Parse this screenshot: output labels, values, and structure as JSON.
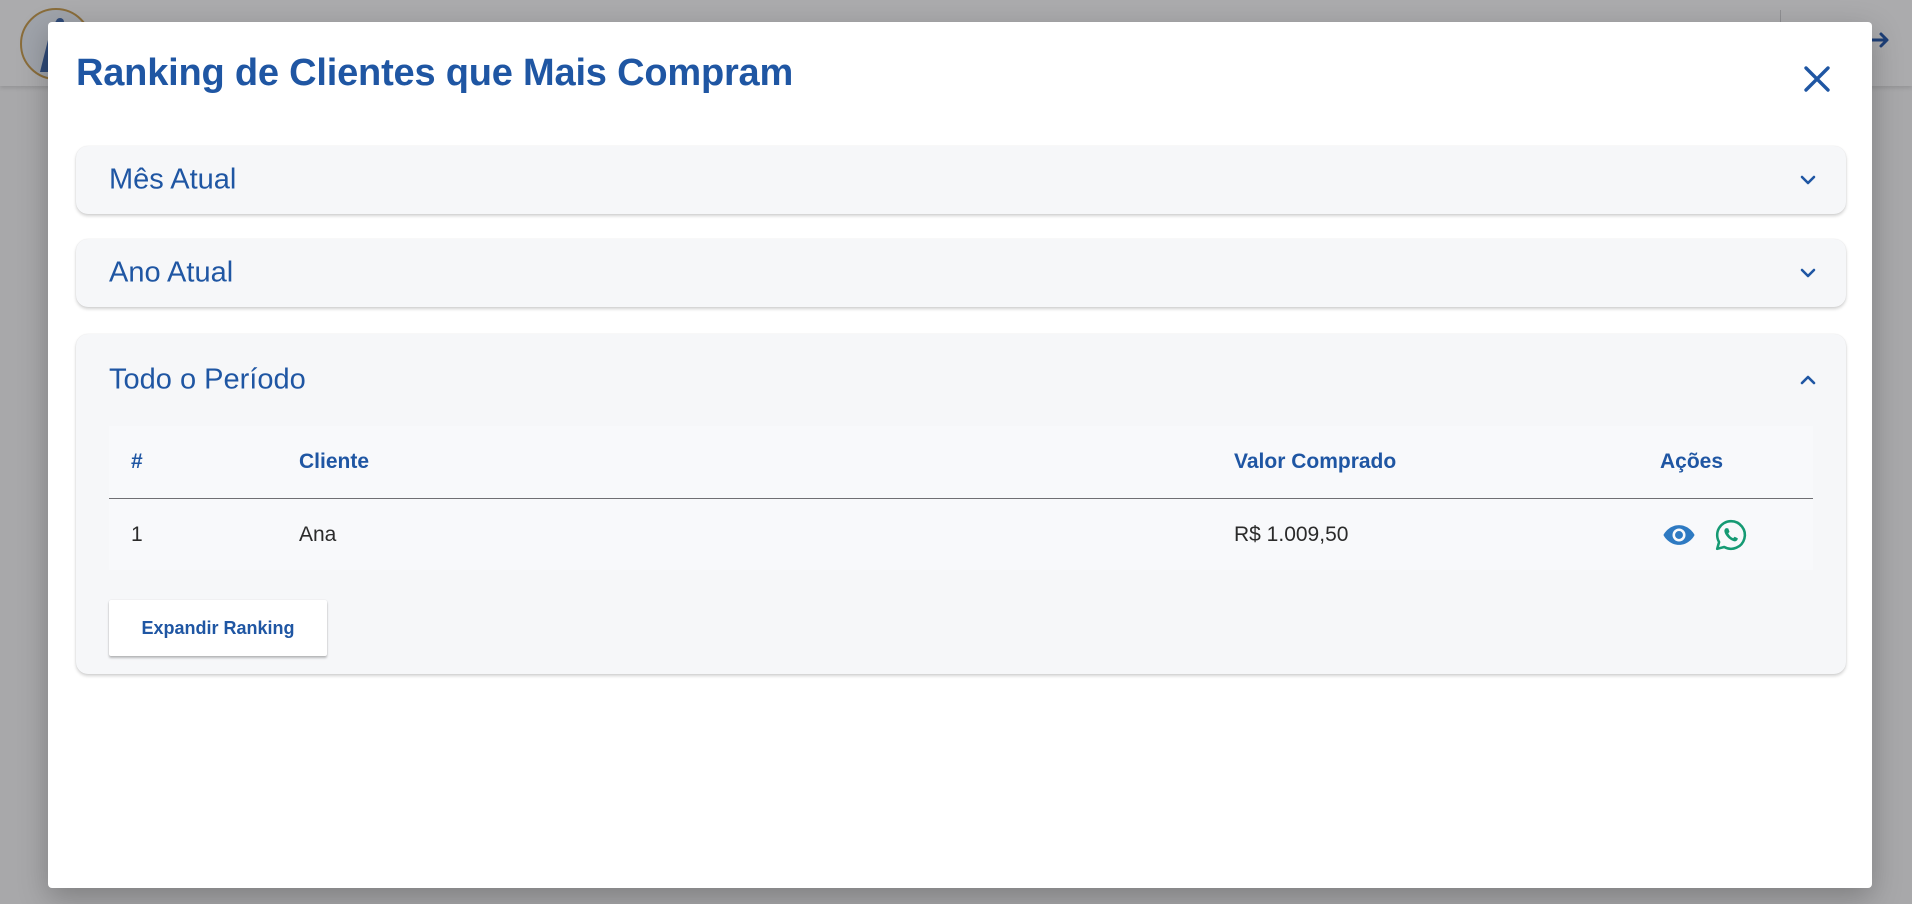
{
  "modal": {
    "title": "Ranking de Clientes que Mais Compram",
    "close_icon": "close-icon"
  },
  "accordions": [
    {
      "title": "Mês Atual",
      "expanded": false,
      "icon": "chevron-down-icon"
    },
    {
      "title": "Ano Atual",
      "expanded": false,
      "icon": "chevron-down-icon"
    },
    {
      "title": "Todo o Período",
      "expanded": true,
      "icon": "chevron-up-icon"
    }
  ],
  "ranking_table": {
    "headers": [
      "#",
      "Cliente",
      "Valor Comprado",
      "Ações"
    ],
    "rows": [
      {
        "rank": "1",
        "client": "Ana",
        "value": "R$ 1.009,50",
        "actions": [
          "eye-icon",
          "whatsapp-icon"
        ]
      }
    ]
  },
  "expand_button_label": "Expandir Ranking",
  "colors": {
    "primary": "#1f56a3",
    "eye_icon": "#2e7ac2",
    "whatsapp_icon": "#159a73",
    "overlay": "#a8a8aa"
  }
}
